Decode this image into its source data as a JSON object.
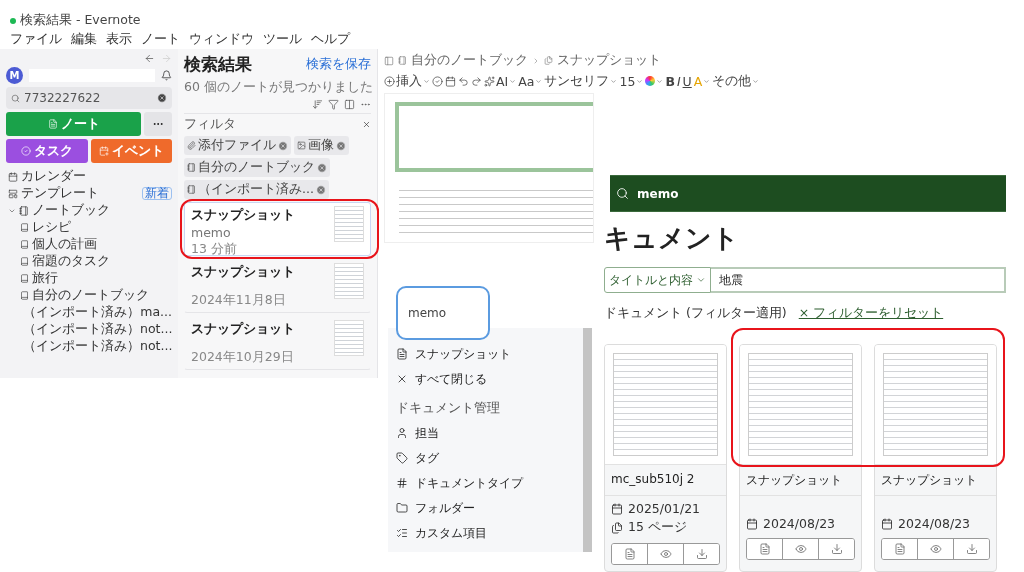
{
  "evernote": {
    "window_title": "検索結果 - Evernote",
    "menu": [
      "ファイル",
      "編集",
      "表示",
      "ノート",
      "ウィンドウ",
      "ツール",
      "ヘルプ"
    ],
    "nav": {
      "back_disabled": false,
      "forward_disabled": true
    },
    "sidebar": {
      "avatar_initial": "M",
      "search_value": "7732227622",
      "new_buttons": [
        {
          "label": "ノート",
          "kind": "note"
        },
        {
          "label": "タスク",
          "kind": "task"
        },
        {
          "label": "イベント",
          "kind": "event"
        }
      ],
      "items": [
        {
          "label": "カレンダー",
          "kind": "calendar"
        },
        {
          "label": "テンプレート",
          "kind": "template",
          "badge": "新着"
        },
        {
          "label": "ノートブック",
          "kind": "notebook",
          "expanded": true,
          "children": [
            {
              "label": "レシピ"
            },
            {
              "label": "個人の計画"
            },
            {
              "label": "宿題のタスク"
            },
            {
              "label": "旅行"
            },
            {
              "label": "自分のノートブック"
            },
            {
              "label": "（インポート済み）ma..."
            },
            {
              "label": "（インポート済み）not..."
            },
            {
              "label": "（インポート済み）not..."
            }
          ]
        }
      ]
    },
    "list": {
      "title": "検索結果",
      "save_label": "検索を保存",
      "count": "60 個のノートが見つかりました",
      "filter_label": "フィルタ",
      "filters": [
        {
          "label": "添付ファイル",
          "kind": "attachment"
        },
        {
          "label": "画像",
          "kind": "image"
        },
        {
          "label": "自分のノートブック",
          "kind": "notebook"
        },
        {
          "label": "（インポート済み...",
          "kind": "notebook"
        }
      ],
      "notes": [
        {
          "title": "スナップショット",
          "snippet": "memo",
          "time": "13 分前",
          "selected": true,
          "highlighted": true
        },
        {
          "title": "スナップショット",
          "time": "2024年11月8日",
          "selected": false,
          "highlighted": false
        },
        {
          "title": "スナップショット",
          "time": "2024年10月29日",
          "selected": false,
          "highlighted": false
        }
      ]
    },
    "editor": {
      "breadcrumb": [
        "自分のノートブック",
        "スナップショット"
      ],
      "toolbar": [
        {
          "kind": "insert",
          "label": "挿入"
        },
        {
          "kind": "task"
        },
        {
          "kind": "calendar"
        },
        {
          "kind": "undo"
        },
        {
          "kind": "redo"
        },
        {
          "kind": "ai",
          "label": "AI"
        },
        {
          "kind": "style",
          "label": "Aa"
        },
        {
          "kind": "font",
          "label": "サンセリフ"
        },
        {
          "kind": "size",
          "label": "15"
        },
        {
          "kind": "color"
        },
        {
          "kind": "bold",
          "label": "B"
        },
        {
          "kind": "italic",
          "label": "I"
        },
        {
          "kind": "underline",
          "label": "U"
        },
        {
          "kind": "highlight",
          "label": "A"
        },
        {
          "kind": "more",
          "label": "その他"
        }
      ]
    }
  },
  "memo_callout": {
    "text": "memo"
  },
  "paperless": {
    "sidebar": {
      "items": [
        {
          "label": "スナップショット",
          "kind": "document"
        },
        {
          "label": "すべて閉じる",
          "kind": "close"
        }
      ],
      "section": "ドキュメント管理",
      "manage": [
        {
          "label": "担当",
          "kind": "owner"
        },
        {
          "label": "タグ",
          "kind": "tag"
        },
        {
          "label": "ドキュメントタイプ",
          "kind": "doctype"
        },
        {
          "label": "フォルダー",
          "kind": "folder"
        },
        {
          "label": "カスタム項目",
          "kind": "custom"
        }
      ]
    },
    "main": {
      "search_value": "memo",
      "title": "キュメント",
      "search_mode": "タイトルと内容",
      "query": "地震",
      "result_label": "ドキュメント (フィルター適用)",
      "reset_label": "× フィルターをリセット",
      "cards": [
        {
          "title": "mc_sub510j 2",
          "date": "2025/01/21",
          "pages": "15 ページ",
          "highlighted": false
        },
        {
          "title": "スナップショット",
          "date": "2024/08/23",
          "highlighted": true
        },
        {
          "title": "スナップショット",
          "date": "2024/08/23",
          "highlighted": true
        }
      ]
    }
  }
}
